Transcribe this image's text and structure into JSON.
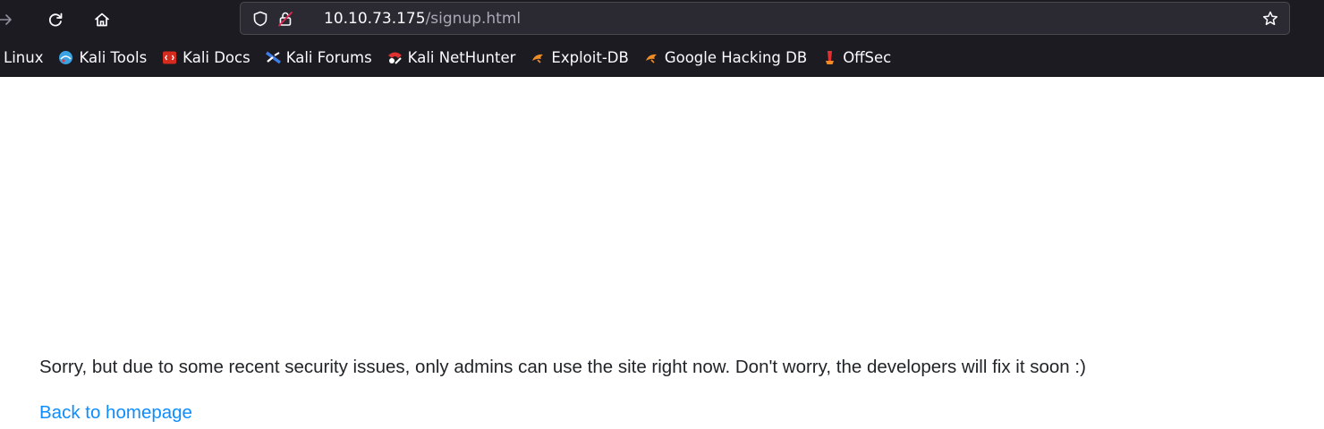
{
  "browser": {
    "url_host": "10.10.73.175",
    "url_path": "/signup.html",
    "icons": {
      "back": "back-arrow-icon",
      "reload": "reload-icon",
      "home": "home-icon",
      "tracking": "shield-icon",
      "insecure": "insecure-lock-icon",
      "bookmark": "star-icon"
    }
  },
  "bookmarks": [
    {
      "label": "Linux",
      "icon": ""
    },
    {
      "label": "Kali Tools",
      "icon": "kali-tools-icon"
    },
    {
      "label": "Kali Docs",
      "icon": "kali-docs-icon"
    },
    {
      "label": "Kali Forums",
      "icon": "kali-forums-icon"
    },
    {
      "label": "Kali NetHunter",
      "icon": "kali-nethunter-icon"
    },
    {
      "label": "Exploit-DB",
      "icon": "exploit-db-icon"
    },
    {
      "label": "Google Hacking DB",
      "icon": "ghdb-icon"
    },
    {
      "label": "OffSec",
      "icon": "offsec-icon"
    }
  ],
  "page": {
    "message": "Sorry, but due to some recent security issues, only admins can use the site right now. Don't worry, the developers will fix it soon :)",
    "link_text": "Back to homepage"
  },
  "colors": {
    "chrome_bg": "#1c1b22",
    "urlbar_bg": "#2b2a33",
    "link": "#0d8dff",
    "text": "#212529"
  }
}
